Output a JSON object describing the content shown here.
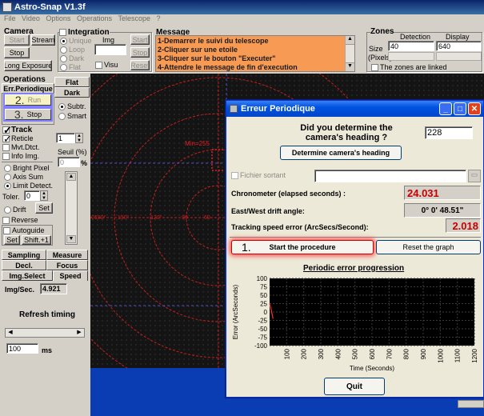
{
  "app": {
    "title": "Astro-Snap V1.3f"
  },
  "menu": [
    "File",
    "Video",
    "Options",
    "Operations",
    "Telescope",
    "?"
  ],
  "camera": {
    "group_label": "Camera",
    "start": "Start",
    "stream": "Stream",
    "stop": "Stop",
    "long_exposure": "Long Exposure"
  },
  "integration": {
    "group_label": "Integration",
    "unique": "Unique",
    "loop": "Loop",
    "dark": "Dark",
    "flat": "Flat",
    "img_label": "Img",
    "visu": "Visu",
    "start": "Start",
    "stop": "Stop",
    "reset": "Reset"
  },
  "message": {
    "group_label": "Message",
    "lines": [
      "1-Demarrer le suivi du telescope",
      "2-Cliquer sur une etoile",
      "3-Cliquer sur le bouton \"Executer\"",
      "4-Attendre le message de fin d'execution"
    ]
  },
  "zones": {
    "group_label": "Zones",
    "detection_label": "Detection",
    "display_label": "Display",
    "size_label": "Size",
    "pixels_label": "(Pixels)",
    "detection_value": "40",
    "display_value": "640",
    "linked_label": "The zones are linked"
  },
  "operations": {
    "group_label": "Operations",
    "err_periodique": "Err.Periodique",
    "run": "Run",
    "run_number": "2.",
    "stop": "Stop",
    "stop_number": "3.",
    "flat": "Flat",
    "dark": "Dark",
    "subtr": "Subtr.",
    "smart": "Smart"
  },
  "track": {
    "label": "Track",
    "reticle": "Reticle",
    "mvt_dtct": "Mvt.Dtct.",
    "info_img": "Info Img.",
    "bright_pixel": "Bright Pixel",
    "axis_sum": "Axis Sum",
    "limit_detect": "Limit Detect.",
    "toler_label": "Toler.",
    "toler_value": "0",
    "drift": "Drift",
    "set": "Set",
    "reverse": "Reverse",
    "autoguide": "Autoguide",
    "set2": "Set",
    "shift": "Shift.+1",
    "spin_value": "1",
    "seuil_label": "Seuil (%)",
    "seuil_value": "0",
    "percent": "%"
  },
  "bottom_tabs": {
    "sampling": "Sampling",
    "measure": "Measure",
    "decl": "Decl.",
    "focus": "Focus",
    "img_select": "Img.Select",
    "speed": "Speed",
    "img_sec_label": "Img/Sec.",
    "img_sec_value": "4.921",
    "refresh_timing": "Refresh timing",
    "timing_value": "100",
    "ms": "ms"
  },
  "sky": {
    "overlay_label": "Min=255",
    "scale_ticks": [
      "180°",
      "150°",
      "120°",
      "90",
      "60"
    ],
    "scale_left": "0°"
  },
  "dialog": {
    "title": "Erreur Periodique",
    "heading_question": "Did you determine the camera's heading ?",
    "heading_value": "228",
    "determine_button": "Determine camera's heading",
    "fichier_sortant": "Fichier sortant",
    "chronometer_label": "Chronometer (elapsed seconds) :",
    "chronometer_value": "24.031",
    "drift_label": "East/West drift angle:",
    "drift_value": "0°  0' 48.51\"",
    "speed_label": "Tracking speed error (ArcSecs/Second):",
    "speed_value": "2.018",
    "start_number": "1.",
    "start_button": "Start the procedure",
    "reset_button": "Reset the graph",
    "graph_title": "Periodic error progression",
    "quit_button": "Quit"
  },
  "chart_data": {
    "type": "line",
    "title": "Periodic error progression",
    "xlabel": "Time (Seconds)",
    "ylabel": "Error (ArcSeconds)",
    "xlim": [
      0,
      1200
    ],
    "ylim": [
      -100,
      100
    ],
    "x_ticks": [
      100,
      200,
      300,
      400,
      500,
      600,
      700,
      800,
      900,
      1000,
      1100,
      1200
    ],
    "y_ticks": [
      100,
      75,
      50,
      25,
      0,
      -25,
      -50,
      -75,
      -100
    ],
    "grid": true,
    "series": [
      {
        "x": [
          0,
          10,
          20
        ],
        "y": [
          25,
          5,
          -20
        ]
      }
    ]
  },
  "colors": {
    "title_bar": "#0a246a",
    "message_bg": "#f79b54",
    "dialog_title": "#0053e1",
    "value_red": "#c80000",
    "highlight": "#ff5050"
  }
}
